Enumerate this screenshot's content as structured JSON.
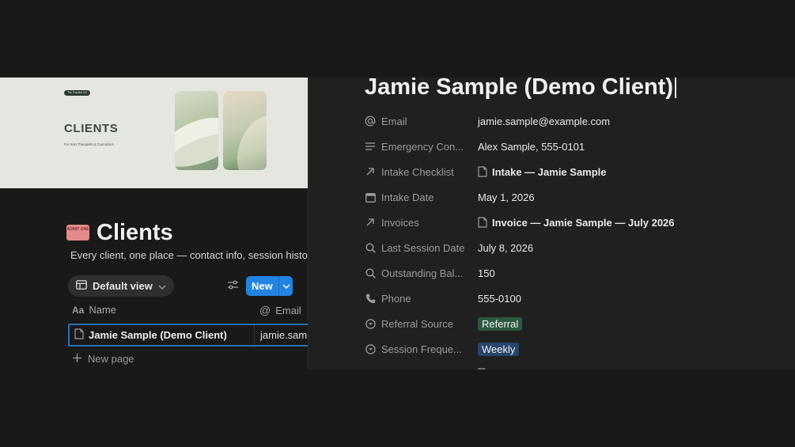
{
  "cover": {
    "pill_text": "The Practice OS",
    "title": "CLIENTS",
    "subtitle": "For Solo Therapists & Counselors"
  },
  "database": {
    "icon_text": "ADMIT ONE",
    "title": "Clients",
    "description": "Every client, one place — contact info, session history, t",
    "view_label": "Default view",
    "new_label": "New",
    "columns": [
      {
        "label": "Name",
        "icon": "text-icon"
      },
      {
        "label": "Email",
        "icon": "at-icon"
      }
    ],
    "rows": [
      {
        "name": "Jamie Sample (Demo Client)",
        "email": "jamie.samp"
      }
    ],
    "new_page_label": "New page"
  },
  "peek": {
    "title": "Jamie Sample (Demo Client)",
    "properties": [
      {
        "name": "Email",
        "icon": "at-icon",
        "value": "jamie.sample@example.com",
        "type": "text"
      },
      {
        "name": "Emergency Con...",
        "icon": "text-lines-icon",
        "value": "Alex Sample, 555-0101",
        "type": "text"
      },
      {
        "name": "Intake Checklist",
        "icon": "relation-arrow-icon",
        "value": "Intake — Jamie Sample",
        "type": "relation"
      },
      {
        "name": "Intake Date",
        "icon": "calendar-icon",
        "value": "May 1, 2026",
        "type": "text"
      },
      {
        "name": "Invoices",
        "icon": "relation-arrow-icon",
        "value": "Invoice — Jamie Sample — July 2026",
        "type": "relation"
      },
      {
        "name": "Last Session Date",
        "icon": "search-icon",
        "value": "July 8, 2026",
        "type": "text"
      },
      {
        "name": "Outstanding Bal...",
        "icon": "search-icon",
        "value": "150",
        "type": "text"
      },
      {
        "name": "Phone",
        "icon": "phone-icon",
        "value": "555-0100",
        "type": "text"
      },
      {
        "name": "Referral Source",
        "icon": "select-icon",
        "value": "Referral",
        "type": "tag",
        "color": "#2b593f"
      },
      {
        "name": "Session Freque...",
        "icon": "select-icon",
        "value": "Weekly",
        "type": "tag",
        "color": "#28456c"
      }
    ]
  },
  "colors": {
    "accent": "#2383e2",
    "background": "#191919",
    "panel": "#202020"
  }
}
